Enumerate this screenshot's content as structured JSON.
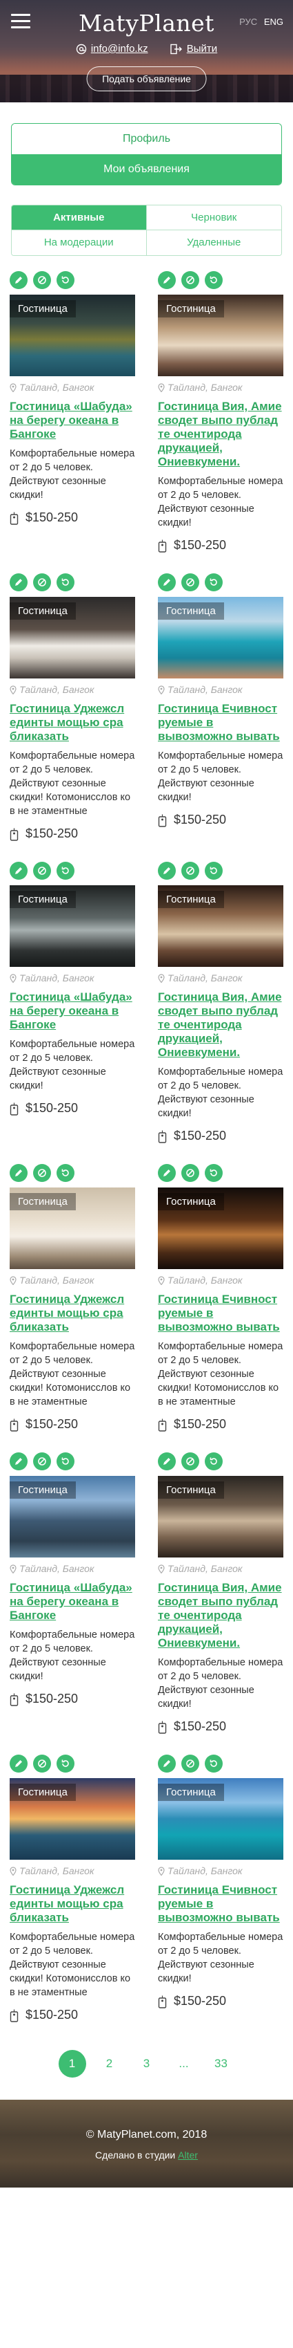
{
  "header": {
    "logo": "MatyPlanet",
    "lang_ru": "РУС",
    "lang_en": "ENG",
    "email": "info@info.kz",
    "logout": "Выйти",
    "post_ad": "Подать объявление"
  },
  "profile_nav": {
    "profile": "Профиль",
    "my_ads": "Мои объявления"
  },
  "status_tabs": {
    "active": "Активные",
    "draft": "Черновик",
    "moderation": "На модерации",
    "deleted": "Удаленные"
  },
  "listings": [
    {
      "category": "Гостиница",
      "location": "Тайланд, Бангок",
      "title": "Гостиница «Шабуда» на берегу океана в Бангоке",
      "desc": "Комфортабельные номера от 2 до 5 человек. Действуют сезонные скидки!",
      "price": "$150-250"
    },
    {
      "category": "Гостиница",
      "location": "Тайланд, Бангок",
      "title": "Гостиница Вия, Амие сводет выпо публад те очентирода друкацией, Ониевкумени.",
      "desc": "Комфортабельные номера от 2 до 5 человек. Действуют сезонные скидки!",
      "price": "$150-250"
    },
    {
      "category": "Гостиница",
      "location": "Тайланд, Бангок",
      "title": "Гостиница Уджежсл единты мощью сра бликазать",
      "desc": "Комфортабельные номера от 2 до 5 человек. Действуют сезонные скидки! Котомонисслов ко в не этаментные",
      "price": "$150-250"
    },
    {
      "category": "Гостиница",
      "location": "Тайланд, Бангок",
      "title": "Гостиница Ечивност руемые в вывозможно вывать",
      "desc": "Комфортабельные номера от 2 до 5 человек. Действуют сезонные скидки!",
      "price": "$150-250"
    },
    {
      "category": "Гостиница",
      "location": "Тайланд, Бангок",
      "title": "Гостиница «Шабуда» на берегу океана в Бангоке",
      "desc": "Комфортабельные номера от 2 до 5 человек. Действуют сезонные скидки!",
      "price": "$150-250"
    },
    {
      "category": "Гостиница",
      "location": "Тайланд, Бангок",
      "title": "Гостиница Вия, Амие сводет выпо публад те очентирода друкацией, Ониевкумени.",
      "desc": "Комфортабельные номера от 2 до 5 человек. Действуют сезонные скидки!",
      "price": "$150-250"
    },
    {
      "category": "Гостиница",
      "location": "Тайланд, Бангок",
      "title": "Гостиница Уджежсл единты мощью сра бликазать",
      "desc": "Комфортабельные номера от 2 до 5 человек. Действуют сезонные скидки! Котомонисслов ко в не этаментные",
      "price": "$150-250"
    },
    {
      "category": "Гостиница",
      "location": "Тайланд, Бангок",
      "title": "Гостиница Ечивност руемые в вывозможно вывать",
      "desc": "Комфортабельные номера от 2 до 5 человек. Действуют сезонные скидки! Котомонисслов ко в не этаментные",
      "price": "$150-250"
    },
    {
      "category": "Гостиница",
      "location": "Тайланд, Бангок",
      "title": "Гостиница «Шабуда» на берегу океана в Бангоке",
      "desc": "Комфортабельные номера от 2 до 5 человек. Действуют сезонные скидки!",
      "price": "$150-250"
    },
    {
      "category": "Гостиница",
      "location": "Тайланд, Бангок",
      "title": "Гостиница Вия, Амие сводет выпо публад те очентирода друкацией, Ониевкумени.",
      "desc": "Комфортабельные номера от 2 до 5 человек. Действуют сезонные скидки!",
      "price": "$150-250"
    },
    {
      "category": "Гостиница",
      "location": "Тайланд, Бангок",
      "title": "Гостиница Уджежсл единты мощью сра бликазать",
      "desc": "Комфортабельные номера от 2 до 5 человек. Действуют сезонные скидки! Котомонисслов ко в не этаментные",
      "price": "$150-250"
    },
    {
      "category": "Гостиница",
      "location": "Тайланд, Бангок",
      "title": "Гостиница Ечивност руемые в вывозможно вывать",
      "desc": "Комфортабельные номера от 2 до 5 человек. Действуют сезонные скидки!",
      "price": "$150-250"
    }
  ],
  "pagination": {
    "pages": [
      "1",
      "2",
      "3",
      "...",
      "33"
    ],
    "current": "1"
  },
  "footer": {
    "copyright": "© MatyPlanet.com, 2018",
    "made_prefix": "Сделано в студии",
    "studio": "Alter"
  },
  "colors": {
    "accent": "#3dbd72",
    "link": "#2fa85f",
    "muted": "#a8a8a8"
  },
  "icons": {
    "actions": [
      "edit-icon",
      "hide-icon",
      "restore-icon"
    ],
    "location": "location-pin-icon",
    "price": "price-tag-icon",
    "email": "email-icon",
    "logout": "logout-icon",
    "menu": "menu-icon"
  }
}
